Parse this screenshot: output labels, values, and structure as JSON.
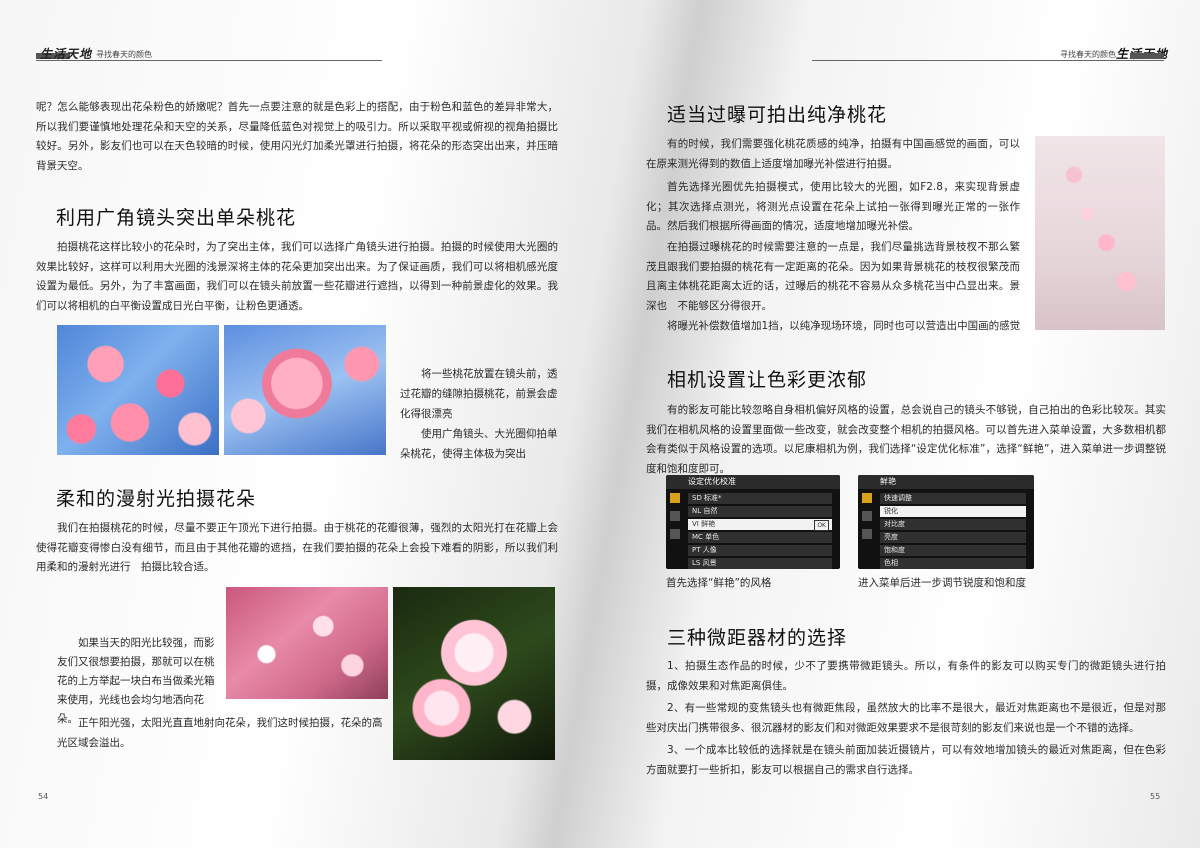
{
  "header": {
    "brand_left": "生活天地",
    "title_left": "寻找春天的颜色",
    "title_right": "寻找春天的颜色",
    "brand_right": "生活天地"
  },
  "left": {
    "intro": "呢？怎么能够表现出花朵粉色的娇嫩呢？首先一点要注意的就是色彩上的搭配，由于粉色和蓝色的差异非常大，所以我们要谨慎地处理花朵和天空的关系，尽量降低蓝色对视觉上的吸引力。所以采取平视或俯视的视角拍摄比较好。另外，影友们也可以在天色较暗的时候，使用闪光灯加柔光罩进行拍摄，将花朵的形态突出出来，并压暗背景天空。",
    "s1_title": "利用广角镜头突出单朵桃花",
    "s1_body": "拍摄桃花这样比较小的花朵时，为了突出主体，我们可以选择广角镜头进行拍摄。拍摄的时候使用大光圈的效果比较好，这样可以利用大光圈的浅景深将主体的花朵更加突出出来。为了保证画质，我们可以将相机感光度设置为最低。另外，为了丰富画面，我们可以在镜头前放置一些花瓣进行遮挡，以得到一种前景虚化的效果。我们可以将相机的白平衡设置成日光白平衡，让粉色更通透。",
    "cap1a": "将一些桃花放置在镜头前，透过花瓣的缝隙拍摄桃花，前景会虚化得很漂亮",
    "cap1b": "使用广角镜头、大光圈仰拍单朵桃花，使得主体极为突出",
    "s2_title": "柔和的漫射光拍摄花朵",
    "s2_body": "我们在拍摄桃花的时候，尽量不要正午顶光下进行拍摄。由于桃花的花瓣很薄，强烈的太阳光打在花瓣上会使得花瓣变得惨白没有细节，而且由于其他花瓣的遮挡，在我们要拍摄的花朵上会投下难看的阴影，所以我们利用柔和的漫射光进行　拍摄比较合适。",
    "cap2a": "如果当天的阳光比较强，而影友们又很想要拍摄，那就可以在桃花的上方举起一块白布当做柔光箱来使用，光线也会均匀地洒向花朵。",
    "cap2b": "正午阳光强，太阳光直直地射向花朵，我们这时候拍摄，花朵的高光区域会溢出。",
    "page_number": "54"
  },
  "right": {
    "s3_title": "适当过曝可拍出纯净桃花",
    "s3_p1": "有的时候，我们需要强化桃花质感的纯净，拍摄有中国画感觉的画面，可以在原来测光得到的数值上适度增加曝光补偿进行拍摄。",
    "s3_p2": "首先选择光圈优先拍摄模式，使用比较大的光圈，如F2.8，来实现背景虚化；其次选择点测光，将测光点设置在花朵上试拍一张得到曝光正常的一张作品。然后我们根据所得画面的情况，适度地增加曝光补偿。",
    "s3_p3": "在拍摄过曝桃花的时候需要注意的一点是，我们尽量挑选背景枝杈不那么繁茂且跟我们要拍摄的桃花有一定距离的花朵。因为如果背景桃花的枝杈很繁茂而且离主体桃花距离太近的话，过曝后的桃花不容易从众多桃花当中凸显出来。景深也　不能够区分得很开。",
    "s3_p4": "将曝光补偿数值增加1挡，以纯净现场环境，同时也可以营造出中国画的感觉",
    "s4_title": "相机设置让色彩更浓郁",
    "s4_body": "有的影友可能比较忽略自身相机偏好风格的设置，总会说自己的镜头不够锐，自己拍出的色彩比较灰。其实我们在相机风格的设置里面做一些改变，就会改变整个相机的拍摄风格。可以首先进入菜单设置，大多数相机都会有类似于风格设置的选项。以尼康相机为例，我们选择“设定优化标准”，选择“鲜艳”，进入菜单进一步调整锐度和饱和度即可。",
    "screen1": {
      "title": "设定优化校准",
      "rows": [
        "SD 标准*",
        "NL 自然",
        "VI 鲜艳",
        "MC 单色",
        "PT 人像",
        "LS 风景"
      ],
      "ok": "OK"
    },
    "screen2": {
      "title": "鲜艳",
      "rows": [
        "快速调整",
        "锐化",
        "对比度",
        "亮度",
        "饱和度",
        "色相"
      ]
    },
    "cap_screen1": "首先选择“鲜艳”的风格",
    "cap_screen2": "进入菜单后进一步调节锐度和饱和度",
    "s5_title": "三种微距器材的选择",
    "s5_p1": "1、拍摄生态作品的时候，少不了要携带微距镜头。所以，有条件的影友可以购买专门的微距镜头进行拍摄，成像效果和对焦距离俱佳。",
    "s5_p2": "2、有一些常规的变焦镜头也有微距焦段，虽然放大的比率不是很大，最近对焦距离也不是很近，但是对那些对庆出门携带很多、很沉器材的影友们和对微距效果要求不是很苛刻的影友们来说也是一个不错的选择。",
    "s5_p3": "3、一个成本比较低的选择就是在镜头前面加装近摄镜片，可以有效地增加镜头的最近对焦距离，但在色彩方面就要打一些折扣，影友可以根据自己的需求自行选择。",
    "page_number": "55"
  }
}
